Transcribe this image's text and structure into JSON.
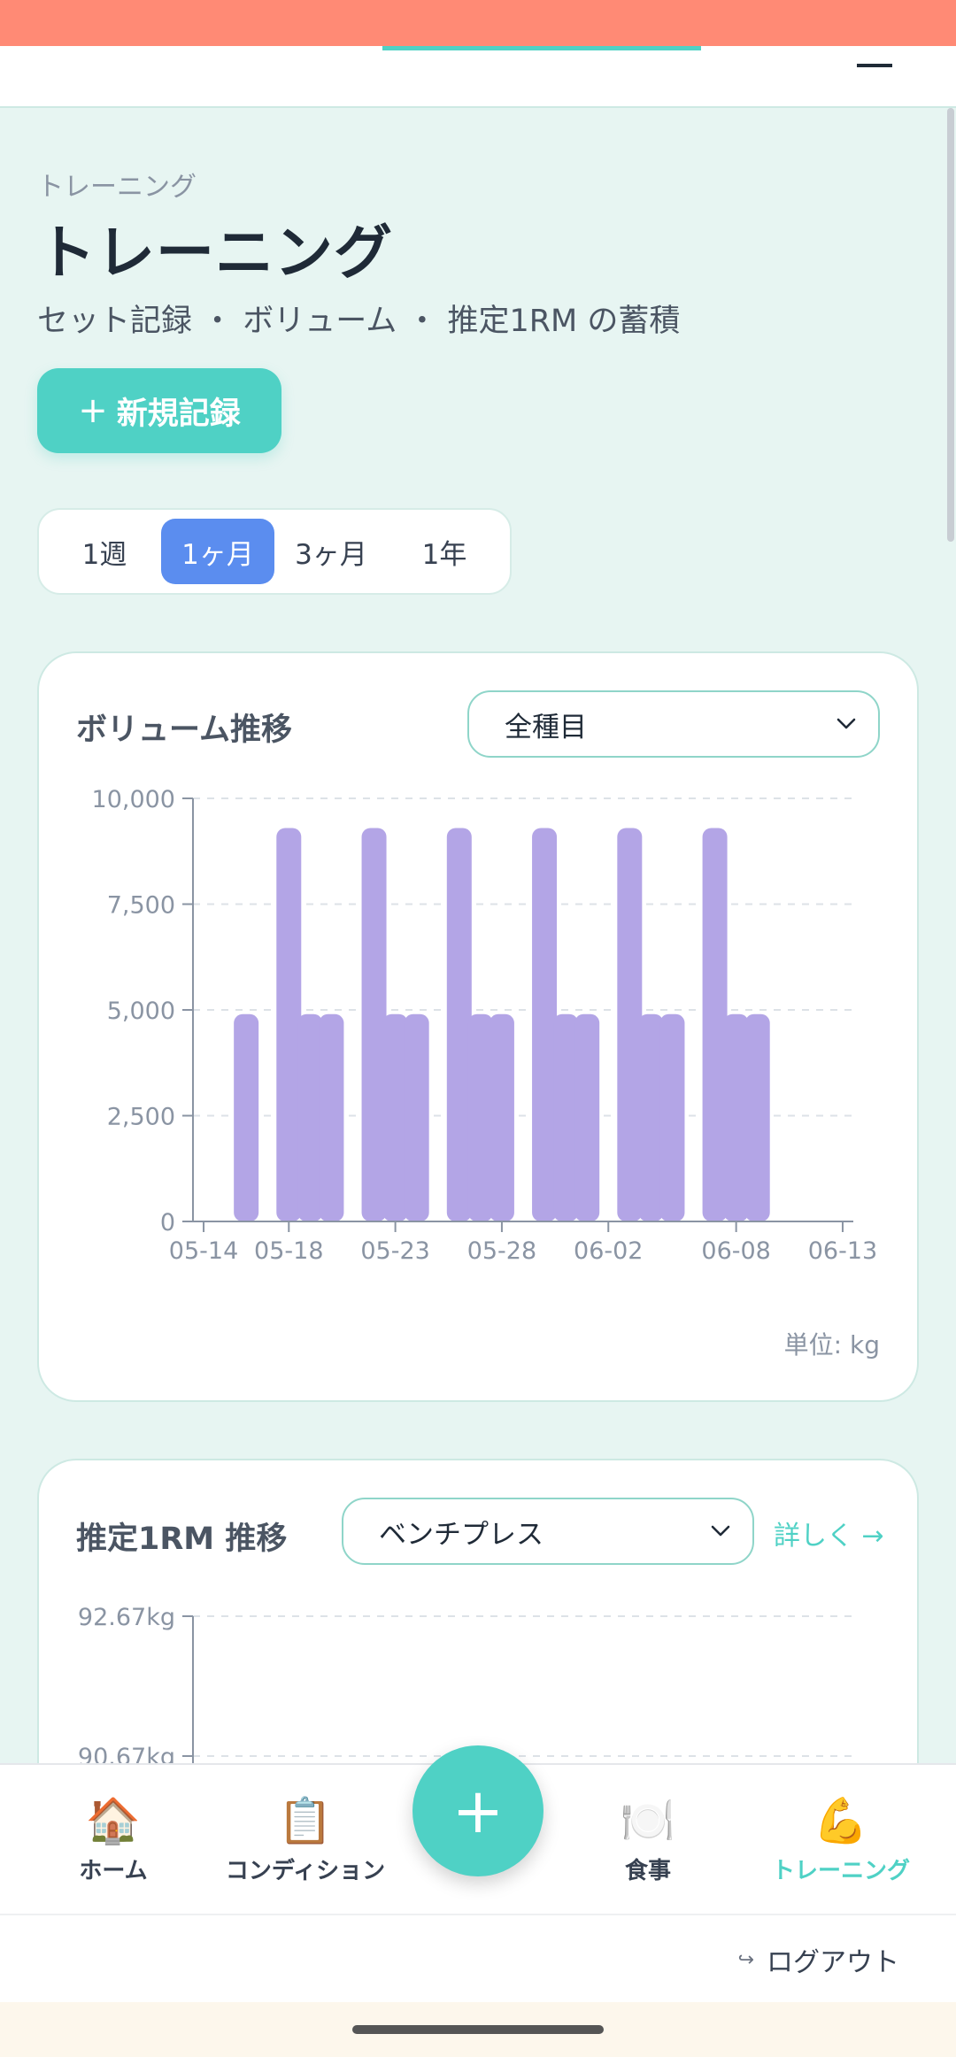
{
  "header": {
    "brand_accent": "",
    "brand_rest": ""
  },
  "breadcrumb": "トレーニング",
  "page": {
    "title": "トレーニング",
    "subtitle": "セット記録 ・ ボリューム ・ 推定1RM の蓄積"
  },
  "new_button": {
    "icon": "plus-icon",
    "label": "新規記録"
  },
  "range_tabs": [
    {
      "label": "1週",
      "active": false
    },
    {
      "label": "1ヶ月",
      "active": true
    },
    {
      "label": "3ヶ月",
      "active": false
    },
    {
      "label": "1年",
      "active": false
    }
  ],
  "volume_card": {
    "title": "ボリューム推移",
    "select_value": "全種目",
    "unit_note": "単位: kg"
  },
  "rm_card": {
    "title": "推定1RM 推移",
    "select_value": "ベンチプレス",
    "detail_link": "詳しく →"
  },
  "chart_data": [
    {
      "type": "bar",
      "title": "ボリューム推移",
      "ylim": [
        0,
        10000
      ],
      "yticks": [
        "0",
        "2,500",
        "5,000",
        "7,500",
        "10,000"
      ],
      "xticks": [
        "05-14",
        "05-18",
        "05-23",
        "05-28",
        "06-02",
        "06-08",
        "06-13"
      ],
      "categories": [
        "05-14",
        "05-15",
        "05-16",
        "05-17",
        "05-18",
        "05-19",
        "05-20",
        "05-21",
        "05-22",
        "05-23",
        "05-24",
        "05-25",
        "05-26",
        "05-27",
        "05-28",
        "05-29",
        "05-30",
        "05-31",
        "06-01",
        "06-02",
        "06-03",
        "06-04",
        "06-05",
        "06-06",
        "06-07",
        "06-08",
        "06-09",
        "06-10",
        "06-11",
        "06-12",
        "06-13"
      ],
      "values": [
        0,
        0,
        4900,
        0,
        9300,
        4900,
        4900,
        0,
        9300,
        4900,
        4900,
        0,
        9300,
        4900,
        4900,
        0,
        9300,
        4900,
        4900,
        0,
        9300,
        4900,
        4900,
        0,
        9300,
        4900,
        4900,
        0,
        0,
        0,
        0
      ],
      "grid": true,
      "color": "#b3a5e6",
      "unit": "kg"
    },
    {
      "type": "line",
      "title": "推定1RM 推移",
      "yticks": [
        "92.67kg",
        "90.67kg"
      ],
      "grid": true
    }
  ],
  "bottom_nav": [
    {
      "icon": "home-icon",
      "emoji": "🏠",
      "label": "ホーム",
      "active": false
    },
    {
      "icon": "clipboard-icon",
      "emoji": "📋",
      "label": "コンディション",
      "active": false
    },
    {
      "icon": "plate-icon",
      "emoji": "🍽️",
      "label": "食事",
      "active": false
    },
    {
      "icon": "muscle-icon",
      "emoji": "💪",
      "label": "トレーニング",
      "active": true
    }
  ],
  "fab": {
    "icon": "plus-icon",
    "label": "+"
  },
  "logout": {
    "icon": "logout-arrow-icon",
    "label": "ログアウト"
  },
  "colors": {
    "accent": "#4fd1c5",
    "tab_active": "#5b8def",
    "bar": "#b3a5e6",
    "status_bar": "#ff8a75"
  }
}
